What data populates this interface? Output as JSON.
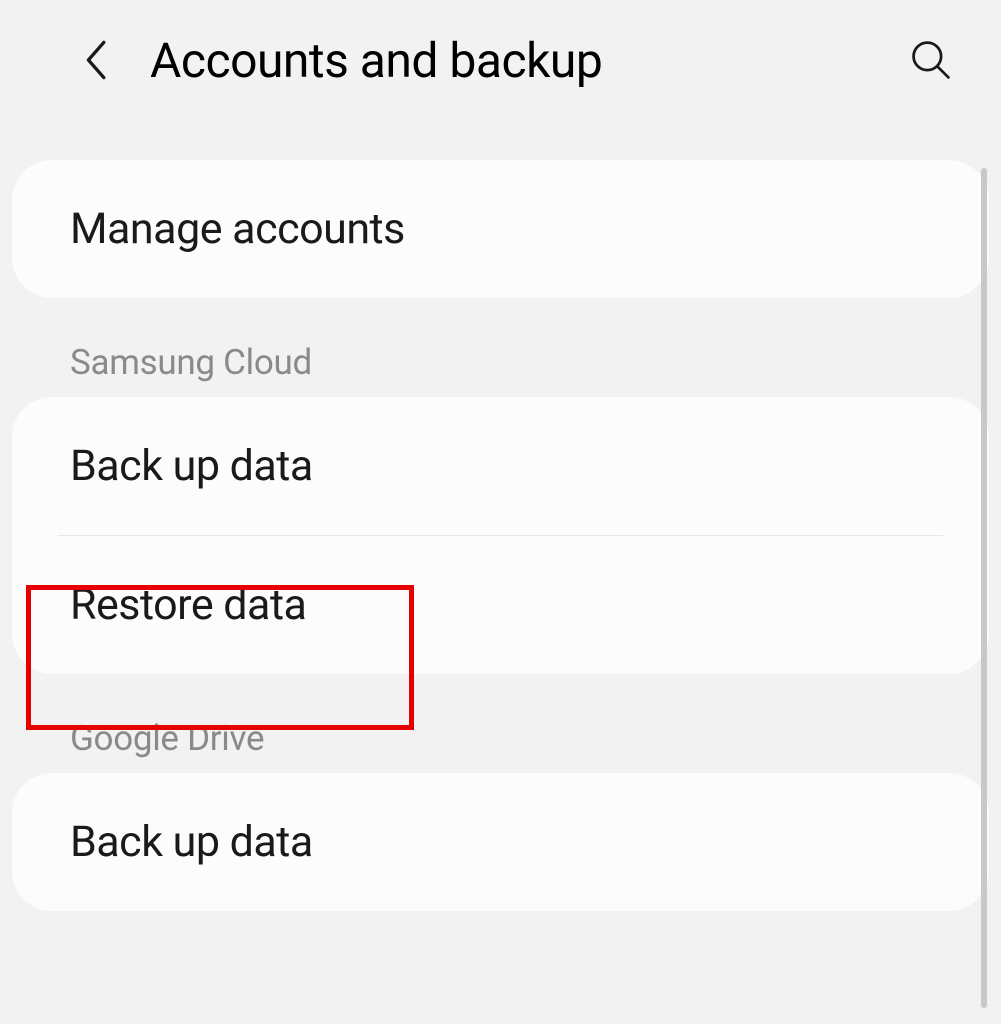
{
  "header": {
    "title": "Accounts and backup"
  },
  "sections": {
    "manage_accounts": "Manage accounts",
    "samsung_cloud_header": "Samsung Cloud",
    "samsung_backup": "Back up data",
    "samsung_restore": "Restore data",
    "google_drive_header": "Google Drive",
    "google_backup": "Back up data"
  },
  "highlight": {
    "target": "restore-data"
  }
}
